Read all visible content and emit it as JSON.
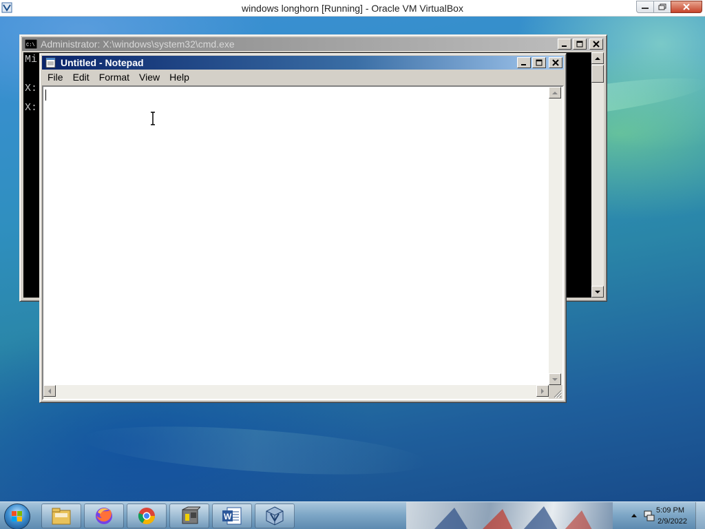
{
  "vbox": {
    "title": "windows longhorn [Running] - Oracle VM VirtualBox",
    "app_icon": "virtualbox-icon",
    "controls": {
      "minimize": "minimize-icon",
      "restore": "restore-icon",
      "close": "close-icon"
    }
  },
  "cmd": {
    "title": "Administrator: X:\\windows\\system32\\cmd.exe",
    "lines": [
      "Mi",
      "X:",
      "X:"
    ]
  },
  "notepad": {
    "title": "Untitled - Notepad",
    "menu": [
      "File",
      "Edit",
      "Format",
      "View",
      "Help"
    ],
    "text": ""
  },
  "taskbar": {
    "start_icon": "windows-start-orb-icon",
    "pinned": [
      {
        "name": "file-explorer-icon"
      },
      {
        "name": "firefox-icon"
      },
      {
        "name": "chrome-icon"
      },
      {
        "name": "application-icon"
      },
      {
        "name": "word-icon"
      },
      {
        "name": "virtualbox-icon"
      }
    ],
    "clock": {
      "time": "5:09 PM",
      "date": "2/9/2022"
    }
  },
  "colors": {
    "caption_active": "#0a246a",
    "caption_inactive": "#808080",
    "window_face": "#d4d0c8"
  }
}
